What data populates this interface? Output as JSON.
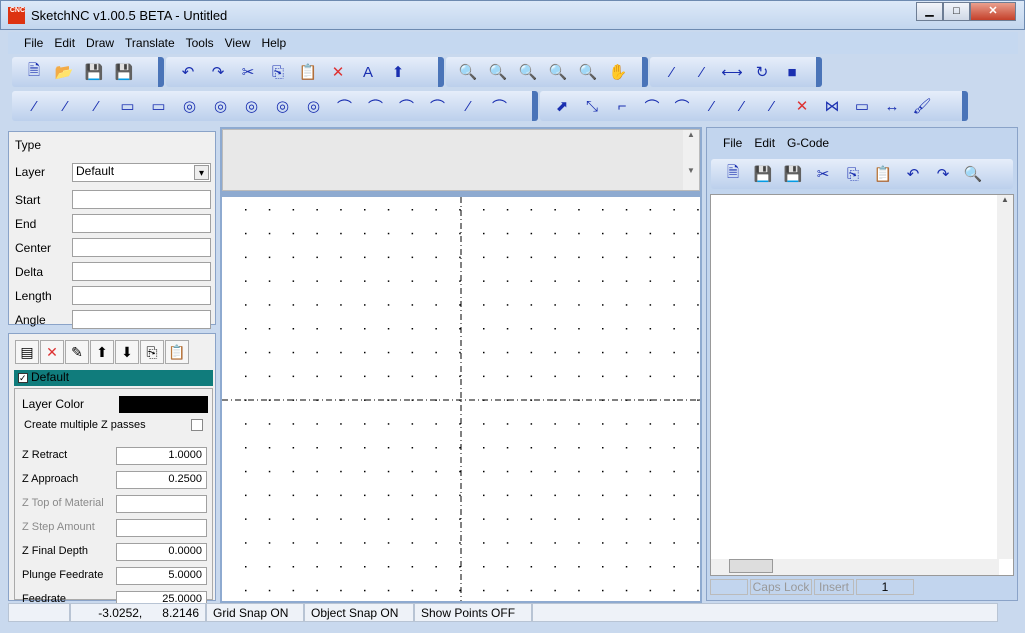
{
  "window": {
    "title": "SketchNC v1.00.5 BETA - Untitled",
    "logo": "CNC",
    "minimize": "▁",
    "maximize": "□",
    "close": "✕"
  },
  "menu": [
    "File",
    "Edit",
    "Draw",
    "Translate",
    "Tools",
    "View",
    "Help"
  ],
  "toolbar1": [
    "new-file-icon",
    "open-folder-icon",
    "save-icon",
    "save-all-icon"
  ],
  "toolbar2": [
    "undo-icon",
    "redo-icon",
    "cut-icon",
    "copy-icon",
    "paste-icon",
    "delete-icon",
    "text-icon",
    "select-arrow-icon"
  ],
  "toolbar3": [
    "zoom-window-icon",
    "zoom-extents-icon",
    "zoom-selection-icon",
    "zoom-in-icon",
    "zoom-out-icon",
    "pan-hand-icon"
  ],
  "toolbar4": [
    "line-icon",
    "parallel-icon",
    "mirror-icon",
    "rotate-icon",
    "fill-icon"
  ],
  "draw_toolbar": [
    "line-tool-icon",
    "angle-line-icon",
    "tangent-line-icon",
    "rectangle-icon",
    "rectangle-corner-icon",
    "circle-center-icon",
    "circle-3pt-icon",
    "circle-tangent-icon",
    "ellipse-icon",
    "ellipse-rotated-icon",
    "arc-icon",
    "arc-3pt-icon",
    "arc-center-icon",
    "arc-tangent-icon",
    "polyline-icon",
    "spline-icon"
  ],
  "edit_toolbar": [
    "move-icon",
    "scale-icon",
    "corner-icon",
    "fillet-icon",
    "offset-icon",
    "trim-icon",
    "extend-icon",
    "break-icon",
    "cut-line-icon",
    "join-icon",
    "node-icon",
    "dimension-icon",
    "brush-icon"
  ],
  "glyphs": {
    "line": "⁄",
    "circle": "◎",
    "arc": "⌒",
    "rect": "▭",
    "zoom": "🔍",
    "default": "◇"
  },
  "properties": {
    "rows": [
      {
        "label": "Type",
        "value": ""
      },
      {
        "label": "Layer",
        "value": "Default"
      },
      {
        "label": "Start",
        "value": ""
      },
      {
        "label": "End",
        "value": ""
      },
      {
        "label": "Center",
        "value": ""
      },
      {
        "label": "Delta",
        "value": ""
      },
      {
        "label": "Length",
        "value": ""
      },
      {
        "label": "Angle",
        "value": ""
      }
    ]
  },
  "layers": {
    "toolbar": [
      "new-layer-icon",
      "delete-layer-icon",
      "edit-layer-icon",
      "move-up-icon",
      "move-down-icon",
      "copy-layer-icon",
      "paste-layer-icon"
    ],
    "selected": "Default",
    "highlight": "#107c7c",
    "color_label": "Layer Color",
    "color": "#000000",
    "multi_z_label": "Create multiple Z passes",
    "fields": [
      {
        "label": "Z Retract",
        "value": "1.0000",
        "enabled": true
      },
      {
        "label": "Z Approach",
        "value": "0.2500",
        "enabled": true
      },
      {
        "label": "Z Top of Material",
        "value": "",
        "enabled": false
      },
      {
        "label": "Z Step Amount",
        "value": "",
        "enabled": false
      },
      {
        "label": "Z Final Depth",
        "value": "0.0000",
        "enabled": true
      },
      {
        "label": "Plunge Feedrate",
        "value": "5.0000",
        "enabled": true
      },
      {
        "label": "Feedrate",
        "value": "25.0000",
        "enabled": true
      }
    ]
  },
  "gcode": {
    "menu": [
      "File",
      "Edit",
      "G-Code"
    ],
    "toolbar": [
      "new-icon",
      "save-icon",
      "save-as-icon",
      "cut-icon",
      "copy-icon",
      "paste-icon",
      "undo-icon",
      "redo-icon",
      "find-icon"
    ],
    "status": [
      "",
      "Caps Lock",
      "Insert",
      "1"
    ]
  },
  "status": {
    "coords_x": "-3.0252,",
    "coords_y": "8.2146",
    "grid_snap": "Grid Snap ON",
    "object_snap": "Object Snap ON",
    "show_points": "Show Points OFF"
  }
}
